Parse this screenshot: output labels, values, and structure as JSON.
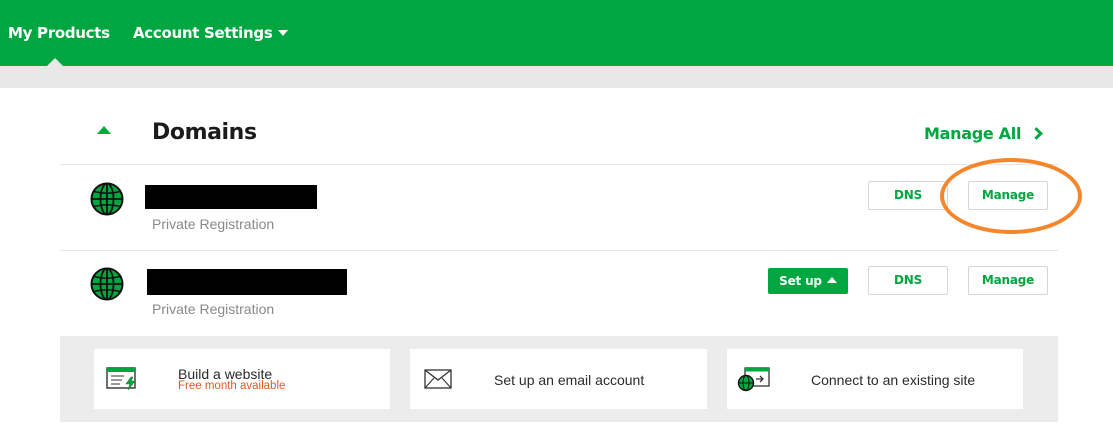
{
  "nav": {
    "my_products": "My Products",
    "account_settings": "Account Settings"
  },
  "section": {
    "title": "Domains",
    "manage_all": "Manage All"
  },
  "domains": [
    {
      "registration": "Private Registration",
      "dns_label": "DNS",
      "manage_label": "Manage"
    },
    {
      "registration": "Private Registration",
      "setup_label": "Set up",
      "dns_label": "DNS",
      "manage_label": "Manage"
    }
  ],
  "suggestions": [
    {
      "title": "Build a website",
      "subtitle": "Free month available",
      "icon": "website-builder-icon"
    },
    {
      "title": "Set up an email account",
      "icon": "envelope-icon"
    },
    {
      "title": "Connect to an existing site",
      "icon": "connect-site-icon"
    }
  ],
  "colors": {
    "brand_green": "#00a63f",
    "highlight_orange": "#f5862b",
    "promo_orange": "#e05a1c"
  }
}
